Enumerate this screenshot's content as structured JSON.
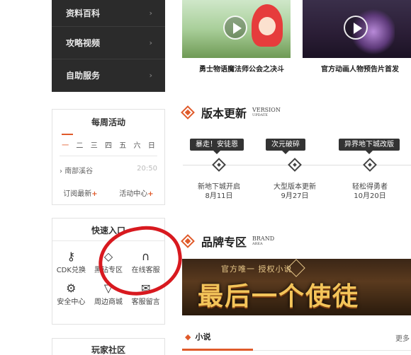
{
  "dark_nav": {
    "items": [
      {
        "label": "资料百科"
      },
      {
        "label": "攻略视频"
      },
      {
        "label": "自助服务"
      }
    ]
  },
  "weekly": {
    "title": "每周活动",
    "days": [
      "一",
      "二",
      "三",
      "四",
      "五",
      "六",
      "日"
    ],
    "event_name": "南部溪谷",
    "event_time": "20:50",
    "link1": "订阅最新",
    "link2": "活动中心",
    "plus": "+"
  },
  "quick": {
    "title": "快速入口",
    "items": [
      {
        "label": "CDK兑换",
        "icon": "key-icon"
      },
      {
        "label": "黑钻专区",
        "icon": "diamond-icon"
      },
      {
        "label": "在线客服",
        "icon": "headset-icon"
      },
      {
        "label": "安全中心",
        "icon": "gear-icon"
      },
      {
        "label": "周边商城",
        "icon": "tshirt-icon"
      },
      {
        "label": "客服留言",
        "icon": "message-icon"
      }
    ]
  },
  "community": {
    "title": "玩家社区"
  },
  "videos": [
    {
      "caption": "勇士物语魔法师公会之决斗"
    },
    {
      "caption": "官方动画人物预告片首发"
    }
  ],
  "version": {
    "title": "版本更新",
    "en_top": "VERSION",
    "en_bottom": "UPDATE",
    "items": [
      {
        "tag": "暴走！安徒恩",
        "name": "新地下城开启",
        "date": "8月11日"
      },
      {
        "tag": "次元破碎",
        "name": "大型版本更新",
        "date": "9月27日"
      },
      {
        "tag": "异界地下城改版",
        "name": "轻松得勇者",
        "date": "10月20日"
      }
    ]
  },
  "brand": {
    "title": "品牌专区",
    "en_top": "BRAND",
    "en_bottom": "AREA",
    "banner_top": "官方唯一 授权小说",
    "banner_big": "最后一个使徒",
    "tab": "小说",
    "more": "更多"
  },
  "colors": {
    "accent": "#e05a2a",
    "annotation": "#d8191f",
    "dark": "#2b2b2b"
  }
}
